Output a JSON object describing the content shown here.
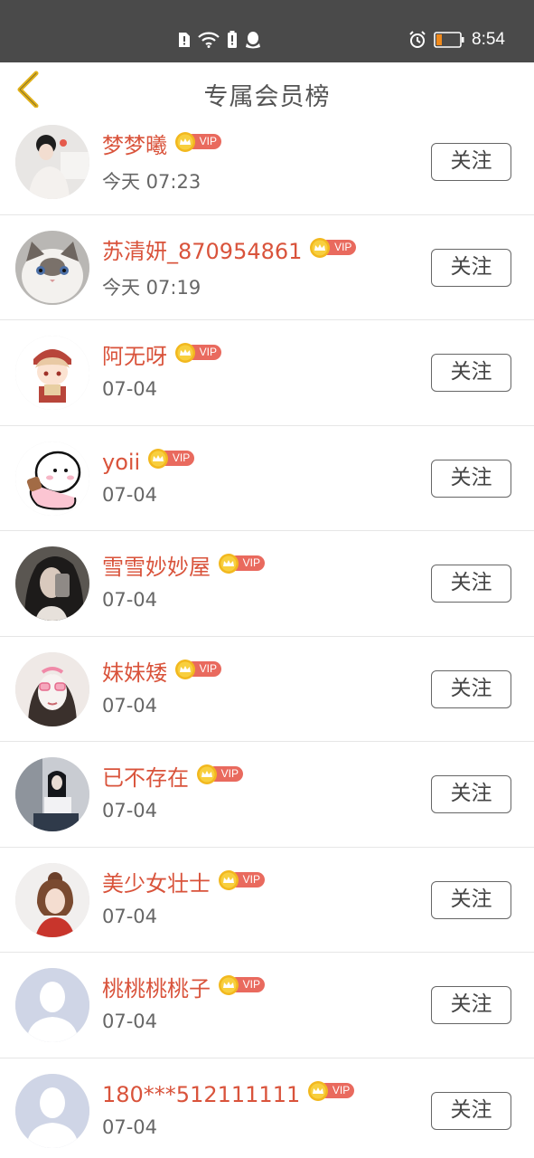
{
  "status_bar": {
    "time": "8:54",
    "icons": [
      "sim-alert-icon",
      "wifi-icon",
      "battery-saver-icon",
      "qq-icon",
      "alarm-icon",
      "battery-icon"
    ]
  },
  "header": {
    "title": "专属会员榜",
    "back_icon": "chevron-left-icon"
  },
  "colors": {
    "name": "#d9533b",
    "time": "#666666",
    "vip_pill": "#e96a5e",
    "crown": "#f2b81e",
    "back_arrow": "#e2b21a",
    "status_bar": "#4a4a4a"
  },
  "vip_label": "VIP",
  "follow_label": "关注",
  "members": [
    {
      "name": "梦梦曦",
      "time": "今天 07:23"
    },
    {
      "name": "苏清妍_870954861",
      "time": "今天 07:19"
    },
    {
      "name": "阿无呀",
      "time": "07-04"
    },
    {
      "name": "yoii",
      "time": "07-04"
    },
    {
      "name": "雪雪妙妙屋",
      "time": "07-04"
    },
    {
      "name": "妹妹矮",
      "time": "07-04"
    },
    {
      "name": "已不存在",
      "time": "07-04"
    },
    {
      "name": "美少女壮士",
      "time": "07-04"
    },
    {
      "name": "桃桃桃桃子",
      "time": "07-04"
    },
    {
      "name": "180***512111111",
      "time": "07-04"
    }
  ]
}
